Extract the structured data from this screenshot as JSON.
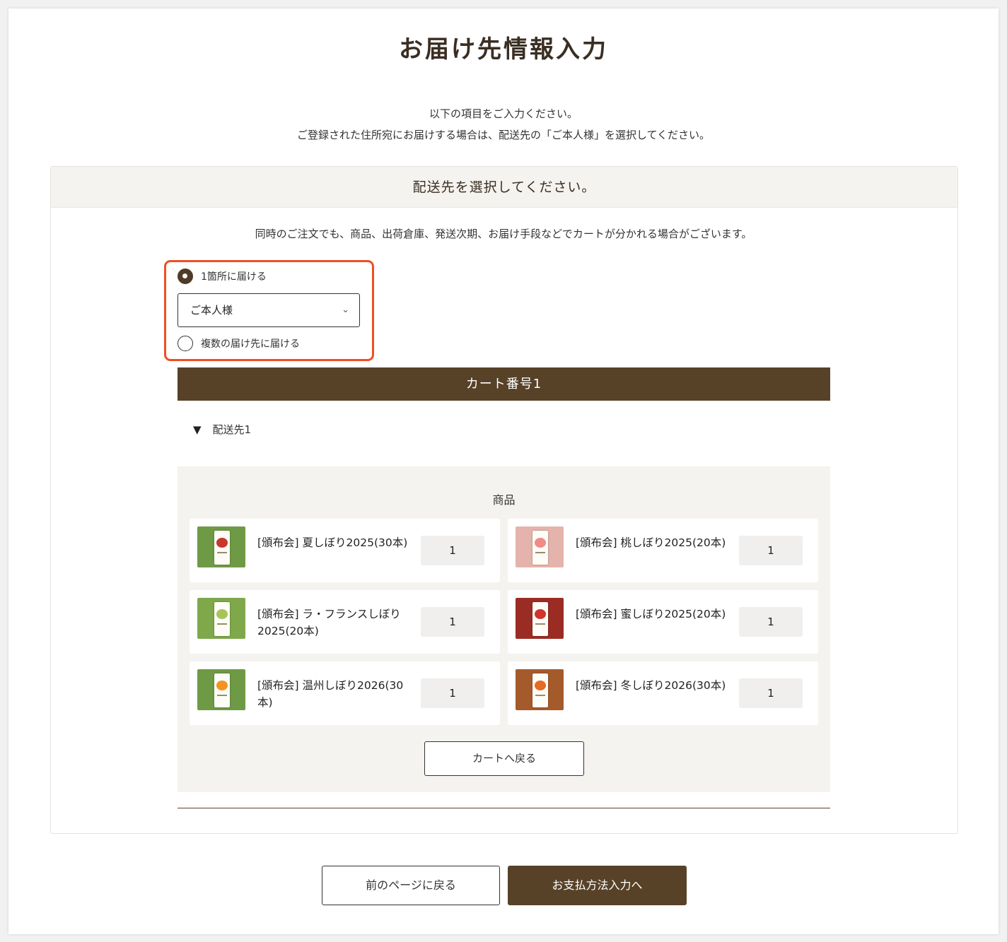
{
  "page": {
    "title": "お届け先情報入力",
    "intro_line1": "以下の項目をご入力ください。",
    "intro_line2": "ご登録された住所宛にお届けする場合は、配送先の「ご本人様」を選択してください。"
  },
  "panel": {
    "heading": "配送先を選択してください。",
    "note": "同時のご注文でも、商品、出荷倉庫、発送次期、お届け手段などでカートが分かれる場合がございます。"
  },
  "delivery": {
    "option_single": "1箇所に届ける",
    "option_multiple": "複数の届け先に届ける",
    "selected_option": "single",
    "recipient_select": "ご本人様",
    "chevron_icon": "chevron-down-icon"
  },
  "cart": {
    "title": "カート番号1",
    "destination_label": "配送先1",
    "goods_heading": "商品",
    "items": [
      {
        "name": "[頒布会] 夏しぼり2025(30本)",
        "qty": "1",
        "tint": "#c8372b",
        "bg": "#6f9a45"
      },
      {
        "name": "[頒布会] 桃しぼり2025(20本)",
        "qty": "1",
        "tint": "#f08b86",
        "bg": "#e4b4ac"
      },
      {
        "name": "[頒布会] ラ・フランスしぼり2025(20本)",
        "qty": "1",
        "tint": "#a7c45a",
        "bg": "#7fa84a"
      },
      {
        "name": "[頒布会] 蜜しぼり2025(20本)",
        "qty": "1",
        "tint": "#d0342b",
        "bg": "#9b2c24"
      },
      {
        "name": "[頒布会] 温州しぼり2026(30本)",
        "qty": "1",
        "tint": "#f29322",
        "bg": "#6f9a45"
      },
      {
        "name": "[頒布会] 冬しぼり2026(30本)",
        "qty": "1",
        "tint": "#e56a22",
        "bg": "#a55a2c"
      }
    ],
    "back_to_cart": "カートへ戻る"
  },
  "footer": {
    "prev_button": "前のページに戻る",
    "next_button": "お支払方法入力へ"
  },
  "colors": {
    "brand_brown": "#574228",
    "highlight": "#f04e23",
    "panel_bg": "#f5f3ef"
  }
}
